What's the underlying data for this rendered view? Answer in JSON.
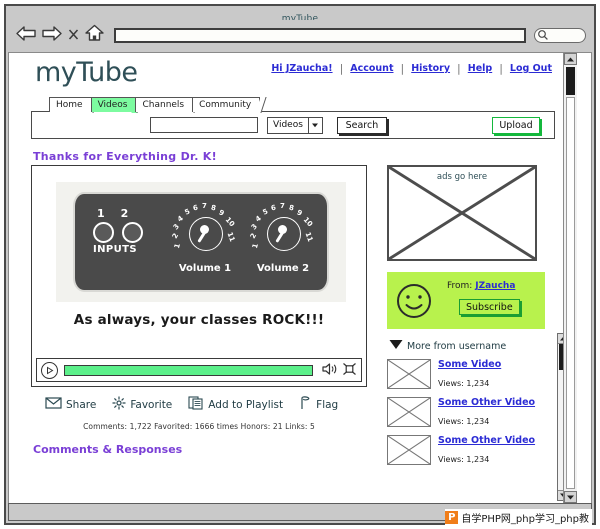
{
  "browser": {
    "window_title": "myTube",
    "url_value": "",
    "back_icon": "back-arrow-icon",
    "forward_icon": "forward-arrow-icon",
    "stop_icon": "close-x-icon",
    "home_icon": "home-icon",
    "search_icon": "magnifier-icon"
  },
  "site": {
    "logo": "myTube",
    "top_links": [
      {
        "label": "Hi JZaucha!"
      },
      {
        "label": "Account"
      },
      {
        "label": "History"
      },
      {
        "label": "Help"
      },
      {
        "label": "Log Out"
      }
    ],
    "tabs": [
      {
        "label": "Home",
        "active": false
      },
      {
        "label": "Videos",
        "active": true
      },
      {
        "label": "Channels",
        "active": false
      },
      {
        "label": "Community",
        "active": false
      }
    ]
  },
  "search": {
    "query_value": "",
    "scope_selected": "Videos",
    "search_button": "Search",
    "upload_button": "Upload"
  },
  "video": {
    "title": "Thanks for Everything Dr. K!",
    "caption": "As always, your classes ROCK!!!",
    "amp": {
      "inputs_label": "INPUTS",
      "input_numbers": [
        "1",
        "2"
      ],
      "knobs": [
        {
          "label": "Volume 1",
          "ticks": [
            "1",
            "2",
            "3",
            "4",
            "5",
            "6",
            "7",
            "8",
            "9",
            "10",
            "11"
          ]
        },
        {
          "label": "Volume 2",
          "ticks": [
            "1",
            "2",
            "3",
            "4",
            "5",
            "6",
            "7",
            "8",
            "9",
            "10",
            "11"
          ]
        }
      ]
    },
    "controls": {
      "play_icon": "play-icon",
      "progress_percent": 100,
      "volume_icon": "speaker-icon",
      "fullscreen_icon": "fullscreen-icon"
    },
    "actions": [
      {
        "label": "Share",
        "icon": "envelope-icon"
      },
      {
        "label": "Favorite",
        "icon": "sparkle-icon"
      },
      {
        "label": "Add to Playlist",
        "icon": "pages-icon"
      },
      {
        "label": "Flag",
        "icon": "flag-icon"
      }
    ],
    "stats": "Comments: 1,722 Favorited: 1666 times Honors: 21 Links: 5",
    "comments_heading": "Comments & Responses"
  },
  "sidebar": {
    "ad_placeholder": "ads go here",
    "from_label": "From:",
    "from_user": "JZaucha",
    "subscribe_button": "Subscribe",
    "avatar_icon": "smiley-face-icon",
    "more_from": "More from username",
    "more_from_icon": "triangle-down-icon",
    "videos": [
      {
        "title": "Some Video",
        "views": "Views: 1,234"
      },
      {
        "title": "Some Other Video",
        "views": "Views: 1,234"
      },
      {
        "title": "Some Other Video",
        "views": "Views: 1,234"
      }
    ]
  },
  "watermark": {
    "logo_letter": "P",
    "text": "自学PHP网_php学习_php教"
  },
  "colors": {
    "accent_green": "#7dfba0",
    "panel_green": "#b8f24d",
    "link_blue": "#2b2bd4",
    "title_purple": "#7a3fd6",
    "logo_teal": "#2f4f57"
  }
}
